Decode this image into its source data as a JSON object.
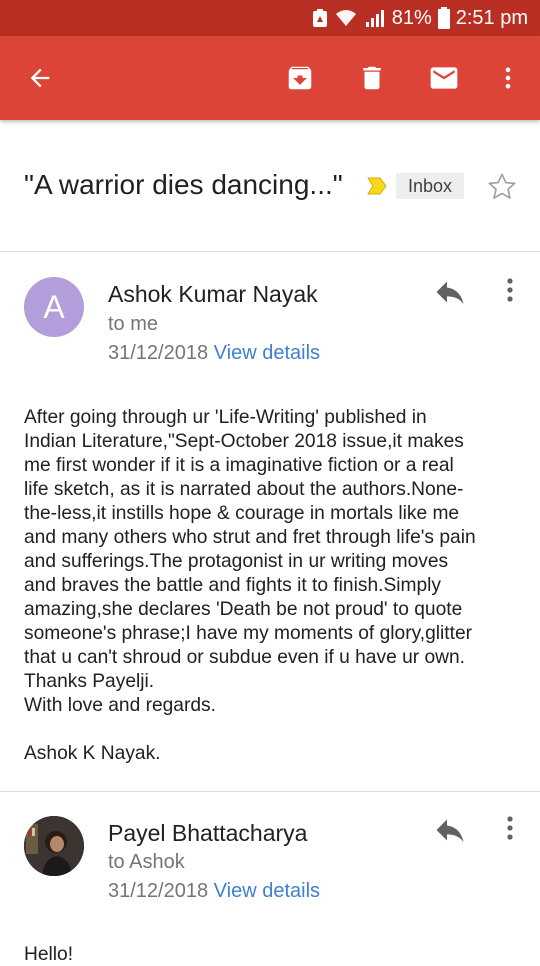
{
  "status_bar": {
    "battery": "81%",
    "time": "2:51 pm"
  },
  "toolbar": {
    "icons": [
      "back-arrow-icon",
      "archive-icon",
      "delete-icon",
      "mail-icon",
      "more-vert-icon"
    ]
  },
  "subject": {
    "title": "\"A warrior dies dancing...\"",
    "label": "Inbox"
  },
  "messages": [
    {
      "avatar_letter": "A",
      "avatar_color": "#b39ddb",
      "sender": "Ashok Kumar Nayak",
      "recipient": "to me",
      "date": "31/12/2018",
      "view_details": "View details",
      "body": [
        "After going through ur 'Life-Writing' published in",
        "Indian Literature,\"Sept-October 2018 issue,it makes",
        "me first wonder if it is a imaginative fiction or a real",
        "life sketch, as it is narrated about the authors.None-",
        "the-less,it instills hope & courage in mortals like me",
        "and many others who strut and fret through life's pain",
        "and sufferings.The protagonist in ur writing moves",
        "and braves the battle and fights it to finish.Simply",
        "amazing,she declares 'Death be not proud' to quote",
        "someone's phrase;I have my moments of glory,glitter",
        "that u can't shroud or subdue even if u have ur own.",
        "Thanks Payelji.",
        "With love and regards.",
        "",
        "Ashok K Nayak."
      ]
    },
    {
      "sender": "Payel Bhattacharya",
      "recipient": "to Ashok",
      "date": "31/12/2018",
      "view_details": "View details",
      "greeting": "Hello!"
    }
  ],
  "colors": {
    "status_bar": "#b92f23",
    "app_bar": "#db4437",
    "link": "#3f7fd4",
    "important": "#f9d71c"
  }
}
